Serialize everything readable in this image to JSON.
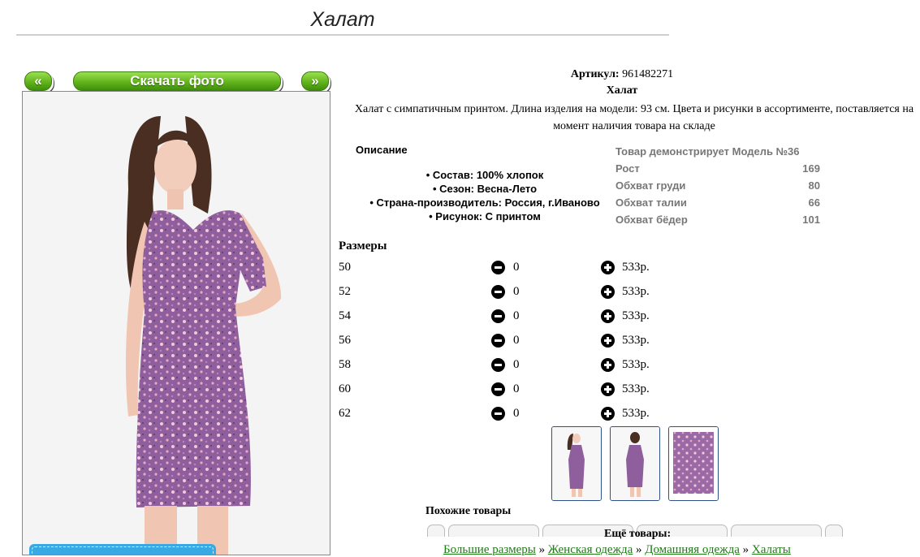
{
  "page": {
    "title": "Халат"
  },
  "photo_nav": {
    "prev_label": "«",
    "download_label": "Скачать фото",
    "next_label": "»"
  },
  "product": {
    "article_label": "Артикул:",
    "article_value": "961482271",
    "name": "Халат",
    "description": "Халат с симпатичным принтом. Длина изделия на модели: 93 см. Цвета и рисунки в ассортименте, поставляется на момент наличия товара на складе"
  },
  "details": {
    "heading": "Описание",
    "features": [
      "• Состав: 100% хлопок",
      "• Сезон: Весна-Лето",
      "• Страна-производитель: Россия, г.Иваново",
      "• Рисунок: С принтом"
    ]
  },
  "model": {
    "heading": "Товар демонстрирует Модель №36",
    "rows": [
      {
        "label": "Рост",
        "value": "169"
      },
      {
        "label": "Обхват груди",
        "value": "80"
      },
      {
        "label": "Обхват талии",
        "value": "66"
      },
      {
        "label": "Обхват бёдер",
        "value": "101"
      }
    ]
  },
  "sizes": {
    "heading": "Размеры",
    "rows": [
      {
        "size": "50",
        "qty": "0",
        "price": "533р."
      },
      {
        "size": "52",
        "qty": "0",
        "price": "533р."
      },
      {
        "size": "54",
        "qty": "0",
        "price": "533р."
      },
      {
        "size": "56",
        "qty": "0",
        "price": "533р."
      },
      {
        "size": "58",
        "qty": "0",
        "price": "533р."
      },
      {
        "size": "60",
        "qty": "0",
        "price": "533р."
      },
      {
        "size": "62",
        "qty": "0",
        "price": "533р."
      }
    ]
  },
  "similar": {
    "heading": "Похожие товары"
  },
  "more": {
    "heading": "Ещё товары:"
  },
  "breadcrumbs": {
    "items": [
      "Большие размеры",
      "Женская одежда",
      "Домашняя одежда",
      "Халаты"
    ],
    "separator": "»"
  },
  "colors": {
    "button_green": "#62b41c",
    "link_green": "#1d7b14",
    "thumb_border": "#30508a",
    "dress_purple": "#8e5f9c",
    "accent_blue": "#39a9e3"
  }
}
